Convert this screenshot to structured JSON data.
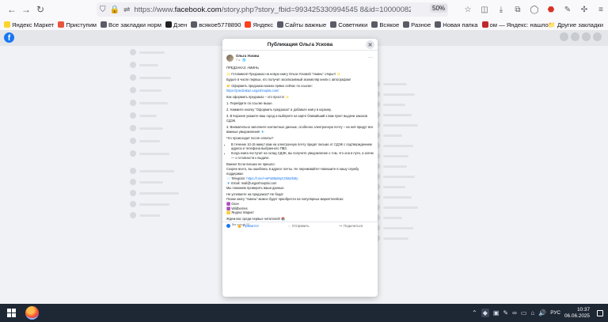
{
  "browser": {
    "url_prefix": "https://www.",
    "url_domain": "facebook.com",
    "url_rest": "/story.php?story_fbid=993425330994545 8&id=100000826626015&mibextid=",
    "zoom": "50%"
  },
  "bookmarks": [
    {
      "label": "Яндекс Маркет",
      "color": "#fed42b"
    },
    {
      "label": "Приступим",
      "color": "#e8553d"
    },
    {
      "label": "Все закладки норм",
      "color": "#5b5b66"
    },
    {
      "label": "Дзен",
      "color": "#222"
    },
    {
      "label": "всякое5778890",
      "color": "#5b5b66"
    },
    {
      "label": "Яндекс",
      "color": "#fc3f1d"
    },
    {
      "label": "Сайты важные",
      "color": "#5b5b66"
    },
    {
      "label": "Советники",
      "color": "#5b5b66"
    },
    {
      "label": "Всякое",
      "color": "#5b5b66"
    },
    {
      "label": "Разное",
      "color": "#5b5b66"
    },
    {
      "label": "Новая папка",
      "color": "#5b5b66"
    },
    {
      "label": "ом — Яндекс: нашло...",
      "color": "#c0292a"
    }
  ],
  "bookmarks_other": "Другие закладки",
  "modal": {
    "title": "Публикация Ольга Ускова",
    "author": "Ольга Ускова",
    "time": "7 ч · 🌐",
    "lines": [
      "ПРЕДЗАКАЗ: АМИНЬ",
      "✨ Готовимся! Предзаказ на новую книгу Ольги Усковой \"Аминь\" открыт! ✨",
      "Будьте в числе первых, кто получит эксклюзивный экземпляр книги с автографом!",
      "👉 Оформить предзаказ можно прямо сейчас по ссылке:"
    ],
    "link1": "https://predzakaz.usgoshnoplai.com/",
    "howto_title": "Как оформить предзаказ – это просто! ✨",
    "steps": [
      "1.  Перейдите по ссылке выше.",
      "2.  Нажмите кнопку \"Оформить предзаказ\" и добавьте книгу в корзину.",
      "3.  В Корзине укажите ваш город и выберите на карте ближайший к вам пункт выдачи заказов СДЭК.",
      "4.  Внимательно заполните контактные данные, особенно электронную почту – на неё придут все важные уведомления! 📧"
    ],
    "after_title": "Что происходит после оплаты?",
    "after_items": [
      "В течение 10-15 минут вам на электронную почту придет письмо от СДЭК с подтверждением адреса и телефона выбранного ПВЗ.",
      "Когда книга поступит на склад СДЭК, вы получите уведомление о том, что она в пути, а затем — о готовности к выдаче."
    ],
    "important": "Важно! Если письмо не пришло:",
    "important_2": "Скорее всего, вы ошиблись в адресе почты. Не переживайте! Напишите в нашу службу поддержки:",
    "telegram_label": "📨 Telegram: ",
    "telegram_link": "https://t.me/+wPoB8yMpCOk5ZkMy",
    "email_line": "📧 Email: mail@usgoshnoplai.com",
    "help_line": "Мы поможем проверить ваши данные.",
    "late_title": "Не успеваете на предзаказ? Не беда!",
    "late_text": "Позже книгу \"Аминь\" можно будет приобрести на популярных маркетплейсах:",
    "markets": [
      "🟪 Озон",
      "🟪 Wildberries",
      "🟨 Яндекс Маркет"
    ],
    "closing": "Ждем вас среди первых читателей! 📚",
    "reactions": "Вы и ещё 22",
    "like": "Нравится",
    "send": "Отправить",
    "share": "Поделиться"
  },
  "taskbar": {
    "time": "10:37",
    "date": "06.06.2025",
    "lang": "РУС"
  }
}
